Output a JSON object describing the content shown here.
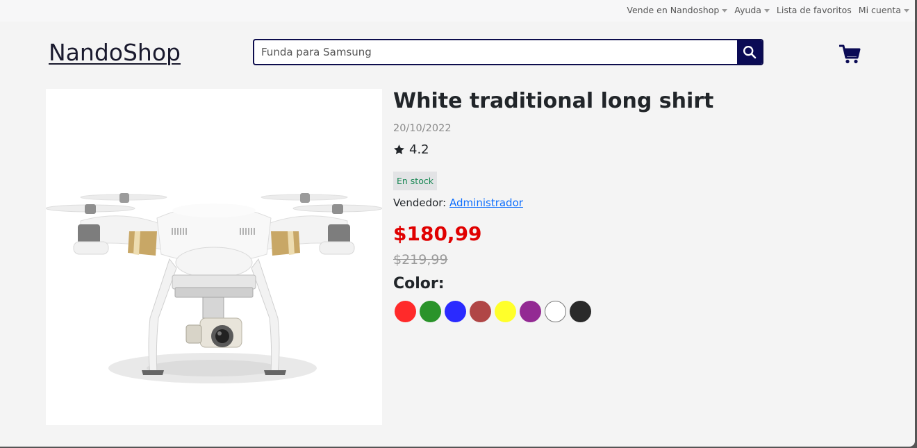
{
  "topnav": {
    "items": [
      {
        "label": "Vende en Nandoshop",
        "has_caret": true
      },
      {
        "label": "Ayuda",
        "has_caret": true
      },
      {
        "label": "Lista de favoritos",
        "has_caret": false
      },
      {
        "label": "Mi cuenta",
        "has_caret": true
      }
    ]
  },
  "header": {
    "logo": "NandoShop",
    "search": {
      "value": "",
      "placeholder": "Funda para Samsung",
      "button_icon": "search-icon"
    },
    "cart_icon": "shopping-cart-icon"
  },
  "product": {
    "image_icon": "drone-product-image",
    "title": "White traditional long shirt",
    "date": "20/10/2022",
    "rating": "4.2",
    "rating_icon": "star-icon",
    "stock": "En stock",
    "seller_label": "Vendedor:",
    "seller_name": "Administrador",
    "price": "$180,99",
    "old_price": "$219,99",
    "color_label": "Color:",
    "colors": [
      {
        "name": "red",
        "hex": "#ff2a2a"
      },
      {
        "name": "green",
        "hex": "#2a932a"
      },
      {
        "name": "blue",
        "hex": "#2a2aff"
      },
      {
        "name": "brown",
        "hex": "#b04646"
      },
      {
        "name": "yellow",
        "hex": "#ffff2a"
      },
      {
        "name": "purple",
        "hex": "#932a93"
      },
      {
        "name": "white",
        "hex": "#ffffff"
      },
      {
        "name": "black",
        "hex": "#2a2a2a"
      }
    ]
  },
  "colors": {
    "navy": "#0b0b55",
    "price_red": "#e00000",
    "link_blue": "#0d6efd",
    "stock_green": "#198754"
  }
}
